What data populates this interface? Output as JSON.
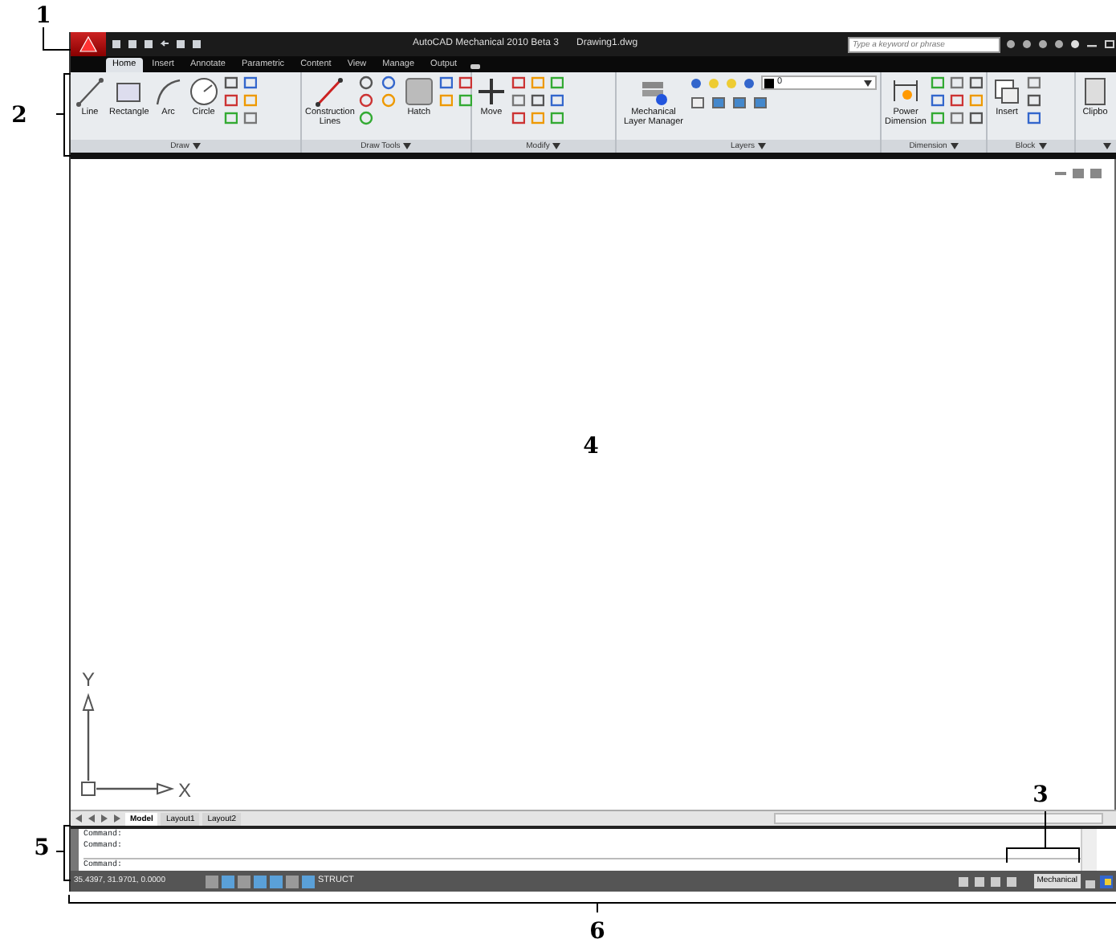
{
  "title_bar": {
    "app_title": "AutoCAD Mechanical 2010 Beta 3",
    "document": "Drawing1.dwg",
    "search": {
      "placeholder": "Type a keyword or phrase"
    }
  },
  "ribbon_tabs": [
    {
      "label": "Home",
      "selected": true
    },
    {
      "label": "Insert",
      "selected": false
    },
    {
      "label": "Annotate",
      "selected": false
    },
    {
      "label": "Parametric",
      "selected": false
    },
    {
      "label": "Content",
      "selected": false
    },
    {
      "label": "View",
      "selected": false
    },
    {
      "label": "Manage",
      "selected": false
    },
    {
      "label": "Output",
      "selected": false
    }
  ],
  "ribbon_panels": [
    {
      "title": "Draw",
      "tools": [
        "Line",
        "Rectangle",
        "Arc",
        "Circle"
      ]
    },
    {
      "title": "Draw Tools",
      "tools": [
        "Construction Lines",
        "Hatch"
      ]
    },
    {
      "title": "Modify",
      "tools": [
        "Move"
      ]
    },
    {
      "title": "Layers",
      "tools": [
        "Mechanical Layer Manager"
      ],
      "layer": "0"
    },
    {
      "title": "Dimension",
      "tools": [
        "Power Dimension"
      ]
    },
    {
      "title": "Block",
      "tools": [
        "Insert"
      ]
    },
    {
      "tools": [
        "Clipbo"
      ]
    }
  ],
  "ucs": {
    "x_label": "X",
    "y_label": "Y"
  },
  "layout_tabs": [
    {
      "label": "Model",
      "selected": true
    },
    {
      "label": "Layout1",
      "selected": false
    },
    {
      "label": "Layout2",
      "selected": false
    }
  ],
  "command_history": [
    "Command:",
    "Command:"
  ],
  "command_prompt": "Command:",
  "status_bar": {
    "coordinates": "35.4397, 31.9701, 0.0000",
    "toggles": [
      {
        "on": false
      },
      {
        "on": true
      },
      {
        "on": false
      },
      {
        "on": true
      },
      {
        "on": true
      },
      {
        "on": false
      },
      {
        "on": true
      }
    ],
    "struct_label": "STRUCT",
    "workspace": "Mechanical"
  },
  "callouts": [
    "1",
    "2",
    "3",
    "4",
    "5",
    "6"
  ]
}
